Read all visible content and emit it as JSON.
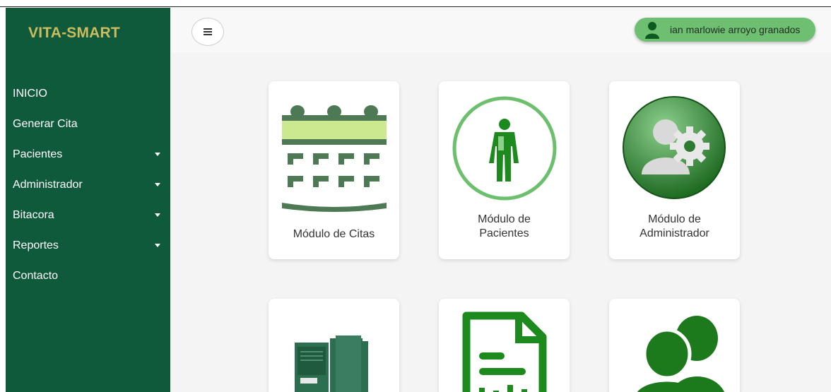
{
  "sidebar": {
    "brand": "VITA-SMART",
    "items": [
      {
        "label": "INICIO",
        "has_caret": false
      },
      {
        "label": "Generar Cita",
        "has_caret": false
      },
      {
        "label": "Pacientes",
        "has_caret": true
      },
      {
        "label": "Administrador",
        "has_caret": true
      },
      {
        "label": "Bitacora",
        "has_caret": true
      },
      {
        "label": "Reportes",
        "has_caret": true
      },
      {
        "label": "Contacto",
        "has_caret": false
      }
    ]
  },
  "header": {
    "menu_icon": "hamburger-icon",
    "user_name": "ian marlowie arroyo granados",
    "user_icon": "user-icon"
  },
  "modules": [
    {
      "title": "Módulo de Citas",
      "icon": "calendar-icon"
    },
    {
      "title_line1": "Módulo de",
      "title_line2": "Pacientes",
      "icon": "patient-icon"
    },
    {
      "title_line1": "Módulo de",
      "title_line2": "Administrador",
      "icon": "admin-gear-icon"
    },
    {
      "icon": "binder-icon"
    },
    {
      "icon": "report-document-icon"
    },
    {
      "icon": "users-icon"
    }
  ],
  "colors": {
    "sidebar": "#0f5a3a",
    "brand": "#cdbb5f",
    "accent": "#6fbf73",
    "icon_green": "#1c8a1c"
  }
}
